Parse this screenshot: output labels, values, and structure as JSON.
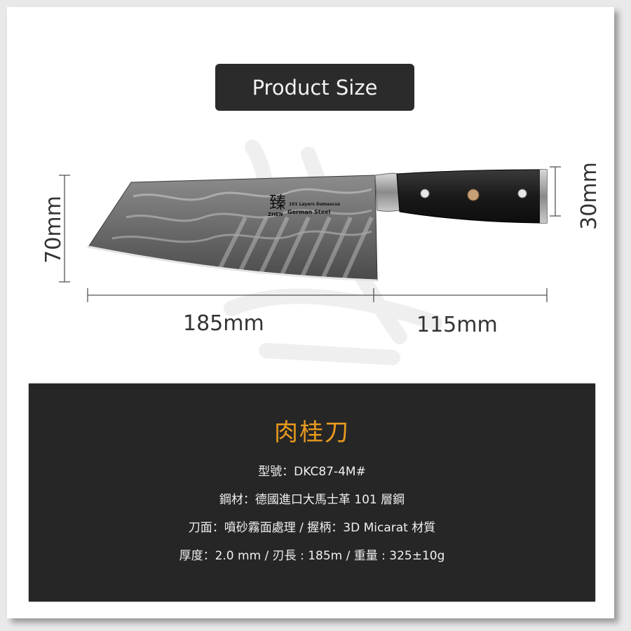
{
  "header": {
    "title": "Product Size"
  },
  "dimensions": {
    "blade_height": "70mm",
    "handle_height": "30mm",
    "blade_length": "185mm",
    "handle_length": "115mm"
  },
  "knife": {
    "logo_char": "臻",
    "brand": "ZHEN",
    "layers": "101 Layers Damascus",
    "steel": "German Steel"
  },
  "specs": {
    "name": "肉桂刀",
    "lines": [
      "型號：DKC87-4M#",
      "鋼材：德國進口大馬士革 101 層鋼",
      "刀面：噴砂霧面處理  / 握柄：3D Micarat 材質",
      "厚度：2.0 mm  / 刃長 : 185m / 重量 : 325±10g"
    ]
  },
  "colors": {
    "panel_bg": "#262626",
    "title_accent": "#e89a1e",
    "pill_bg": "#2b2b2b"
  }
}
